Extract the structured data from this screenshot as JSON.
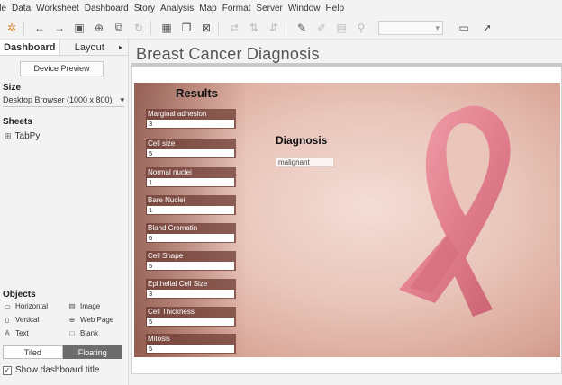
{
  "menu": [
    "ile",
    "Data",
    "Worksheet",
    "Dashboard",
    "Story",
    "Analysis",
    "Map",
    "Format",
    "Server",
    "Window",
    "Help"
  ],
  "sidebar": {
    "tabs": [
      "Dashboard",
      "Layout"
    ],
    "device_preview": "Device Preview",
    "size_title": "Size",
    "size_value": "Desktop Browser (1000 x 800)",
    "sheets_title": "Sheets",
    "sheets": [
      "TabPy"
    ],
    "objects_title": "Objects",
    "objects": [
      "Horizontal",
      "Image",
      "Vertical",
      "Web Page",
      "Text",
      "Blank"
    ],
    "layout_modes": [
      "Tiled",
      "Floating"
    ],
    "show_title_label": "Show dashboard title"
  },
  "dashboard": {
    "title": "Breast Cancer Diagnosis",
    "results_title": "Results",
    "fields": [
      {
        "label": "Marginal adhesion",
        "value": "3"
      },
      {
        "label": "Cell size",
        "value": "5"
      },
      {
        "label": "Normal nuclei",
        "value": "1"
      },
      {
        "label": "Bare Nuclei",
        "value": "1"
      },
      {
        "label": "Bland Cromatin",
        "value": "6"
      },
      {
        "label": "Cell Shape",
        "value": "5"
      },
      {
        "label": "Epithelial Cell Size",
        "value": "3"
      },
      {
        "label": "Cell Thickness",
        "value": "5"
      },
      {
        "label": "Mitosis",
        "value": "5"
      }
    ],
    "diagnosis_title": "Diagnosis",
    "diagnosis_value": "malignant"
  },
  "colors": {
    "ribbon": "#e27c8c",
    "background": "#e9c5ba",
    "toggle_active": "#6c6c6c"
  }
}
